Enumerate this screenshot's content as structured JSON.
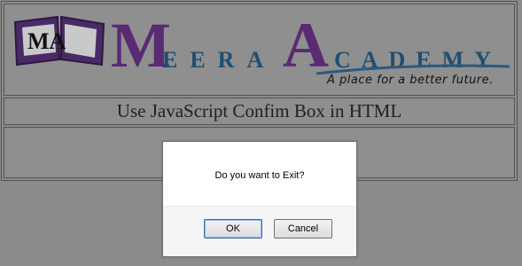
{
  "logo": {
    "book_letters": "MA",
    "big_m": "M",
    "eera": "EERA",
    "big_a": "A",
    "cademy": "CADEMY",
    "tagline": "A place for a better future.",
    "colors": {
      "purple": "#5a2a73",
      "blue": "#1f4f70"
    }
  },
  "page": {
    "title": "Use JavaScript Confim Box in HTML"
  },
  "dialog": {
    "message": "Do you want to Exit?",
    "ok_label": "OK",
    "cancel_label": "Cancel"
  }
}
